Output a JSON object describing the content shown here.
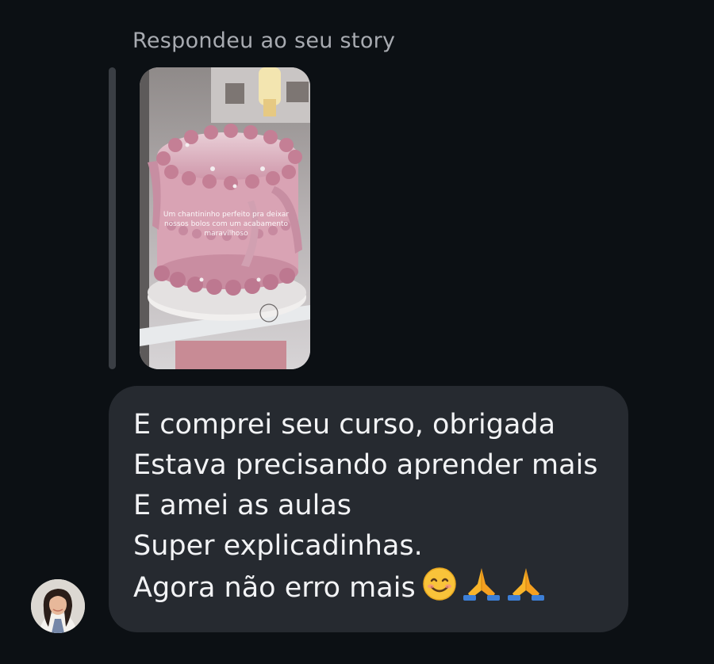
{
  "reply_context": {
    "label": "Respondeu ao seu story"
  },
  "story": {
    "caption": "Um chantininho perfeito pra deixar nossos bolos com um acabamento maravilhoso",
    "colors": {
      "frosting": "#d9a3b4",
      "background": "#b8b4b5"
    }
  },
  "message": {
    "lines": [
      "E comprei seu curso, obrigada",
      "Estava precisando aprender mais",
      "E amei as aulas",
      "Super explicadinhas.",
      "Agora não erro mais"
    ],
    "emojis": [
      "smiling-face-icon",
      "folded-hands-icon",
      "folded-hands-icon"
    ]
  },
  "sender": {
    "avatar_icon": "avatar"
  },
  "theme": {
    "background": "#0c1014",
    "bubble": "#262a30",
    "text": "#f2f3f5",
    "muted": "#a8abb1"
  }
}
